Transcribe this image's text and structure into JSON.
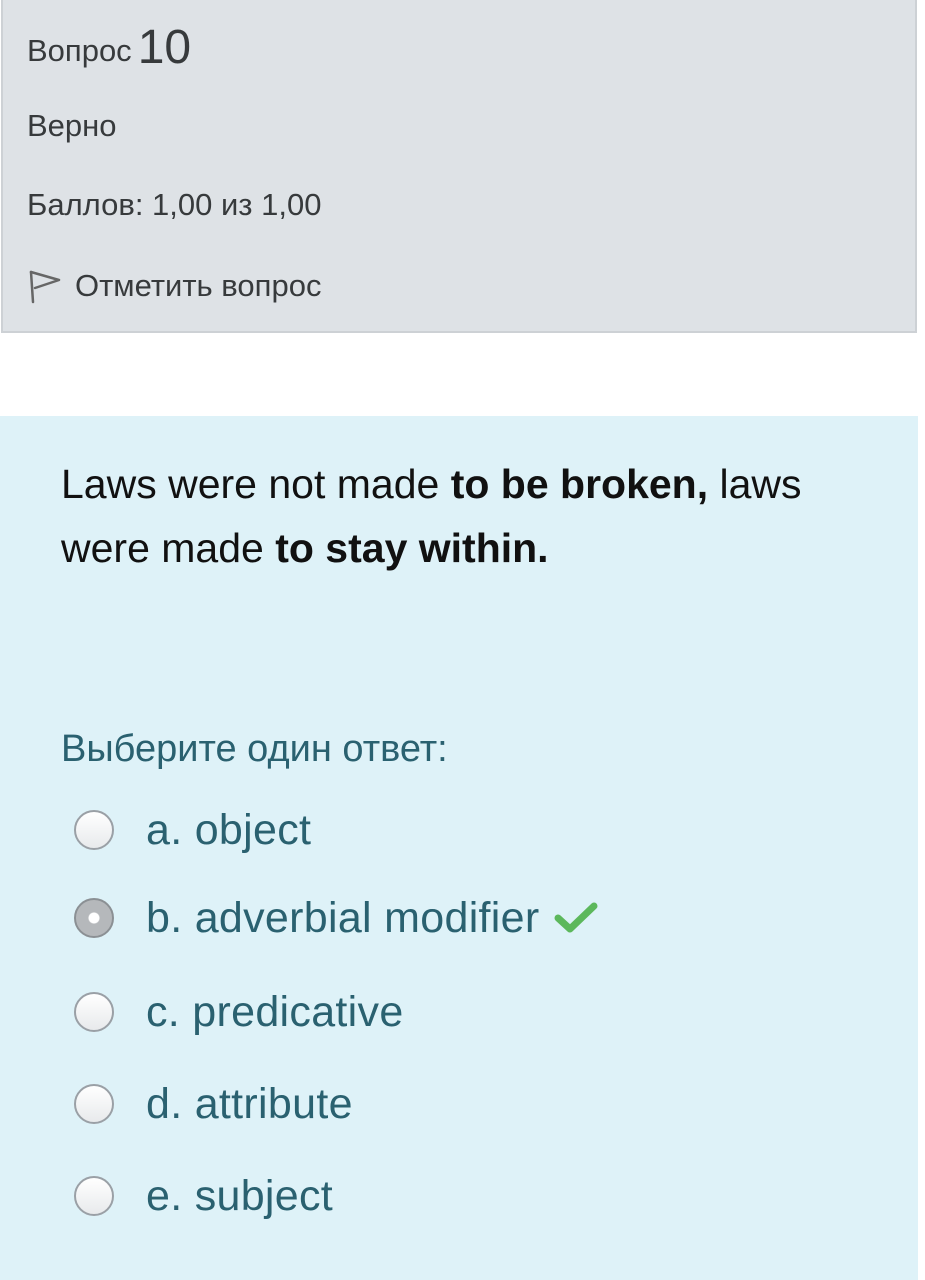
{
  "info": {
    "question_word": "Вопрос",
    "question_number": "10",
    "state": "Верно",
    "grade": "Баллов: 1,00 из 1,00",
    "flag_label": "Отметить вопрос",
    "flag_icon": "flag-icon"
  },
  "question": {
    "text_parts": [
      {
        "text": "Laws were not made ",
        "bold": false
      },
      {
        "text": "to be broken,",
        "bold": true
      },
      {
        "text": " laws were made ",
        "bold": false
      },
      {
        "text": "to stay within.",
        "bold": true
      }
    ],
    "prompt": "Выберите один ответ:",
    "answers": [
      {
        "label": "a. object",
        "selected": false
      },
      {
        "label": "b. adverbial modifier",
        "selected": true,
        "correct": true
      },
      {
        "label": "c. predicative",
        "selected": false
      },
      {
        "label": "d. attribute",
        "selected": false
      },
      {
        "label": "e. subject",
        "selected": false
      }
    ],
    "correct_icon": "check-icon"
  },
  "colors": {
    "info_bg": "#dee2e6",
    "question_bg": "#def2f8",
    "answer_text": "#2a6170",
    "correct_check": "#5cb85c"
  }
}
